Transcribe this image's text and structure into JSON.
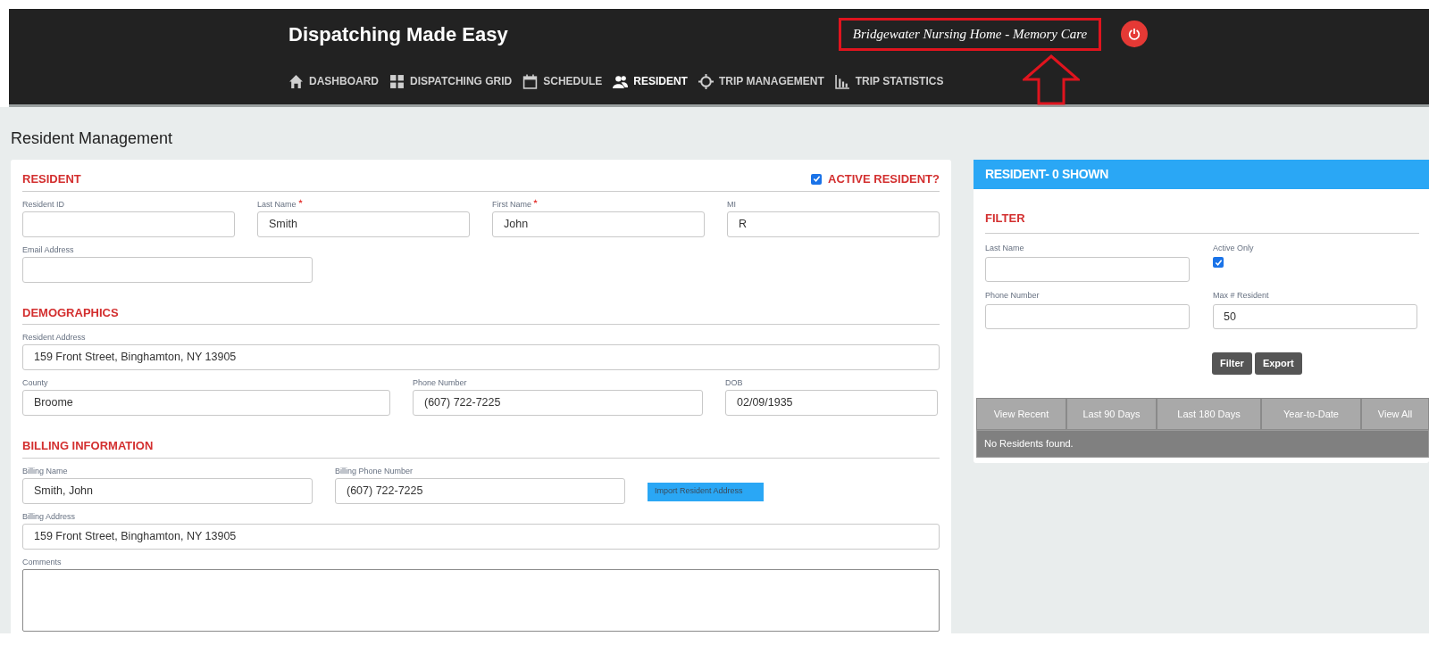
{
  "header": {
    "title": "Dispatching Made Easy",
    "facility": "Bridgewater Nursing Home - Memory Care",
    "nav": [
      {
        "label": "DASHBOARD",
        "selected": false
      },
      {
        "label": "DISPATCHING GRID",
        "selected": false
      },
      {
        "label": "SCHEDULE",
        "selected": false
      },
      {
        "label": "RESIDENT",
        "selected": true
      },
      {
        "label": "TRIP MANAGEMENT",
        "selected": false
      },
      {
        "label": "TRIP STATISTICS",
        "selected": false
      }
    ]
  },
  "page_title": "Resident Management",
  "form": {
    "sections": [
      {
        "heading": "RESIDENT",
        "toggle": {
          "label": "ACTIVE RESIDENT?",
          "checked": true
        },
        "rows": [
          [
            {
              "kind": "text",
              "label": "Resident ID",
              "required": false
            },
            {
              "kind": "text",
              "label": "Last Name",
              "required": true,
              "value": "Smith"
            },
            {
              "kind": "text",
              "label": "First Name",
              "required": true,
              "value": "John"
            },
            {
              "kind": "text",
              "label": "MI",
              "required": false,
              "value": "R"
            }
          ],
          [
            {
              "kind": "text",
              "label": "Email Address",
              "required": false
            }
          ]
        ]
      },
      {
        "heading": "DEMOGRAPHICS",
        "rows": [
          [
            {
              "kind": "text",
              "label": "Resident Address",
              "required": false,
              "value": "159 Front Street, Binghamton, NY 13905"
            }
          ],
          [
            {
              "kind": "text",
              "label": "County",
              "required": false,
              "value": "Broome"
            },
            {
              "kind": "text",
              "label": "Phone Number",
              "required": false,
              "value": "(607) 722-7225"
            },
            {
              "kind": "text",
              "label": "DOB",
              "required": false,
              "value": "02/09/1935"
            }
          ]
        ]
      },
      {
        "heading": "BILLING INFORMATION",
        "rows": [
          [
            {
              "kind": "text",
              "label": "Billing Name",
              "required": false,
              "value": "Smith, John"
            },
            {
              "kind": "text",
              "label": "Billing Phone Number",
              "required": false,
              "value": "(607) 722-7225"
            },
            {
              "kind": "button",
              "label": "Import Resident Address"
            }
          ],
          [
            {
              "kind": "text",
              "label": "Billing Address",
              "required": false,
              "value": "159 Front Street, Binghamton, NY 13905"
            }
          ],
          [
            {
              "kind": "textarea",
              "label": "Comments",
              "required": false
            }
          ]
        ]
      }
    ]
  },
  "results": {
    "title": "RESIDENT- 0 SHOWN",
    "filter_heading": "FILTER",
    "filters": [
      {
        "kind": "text",
        "label": "Last Name"
      },
      {
        "kind": "checkbox",
        "label": "Active Only",
        "checked": true
      },
      {
        "kind": "text",
        "label": "Phone Number"
      },
      {
        "kind": "text",
        "label": "Max # Resident",
        "value": "50"
      }
    ],
    "buttons": [
      "Filter",
      "Export"
    ],
    "tabs": [
      {
        "label": "View Recent",
        "selected": false
      },
      {
        "label": "Last 90 Days",
        "selected": false
      },
      {
        "label": "Last 180 Days",
        "selected": false
      },
      {
        "label": "Year-to-Date",
        "selected": false
      },
      {
        "label": "View All",
        "selected": false
      }
    ],
    "empty_message": "No Residents found."
  }
}
